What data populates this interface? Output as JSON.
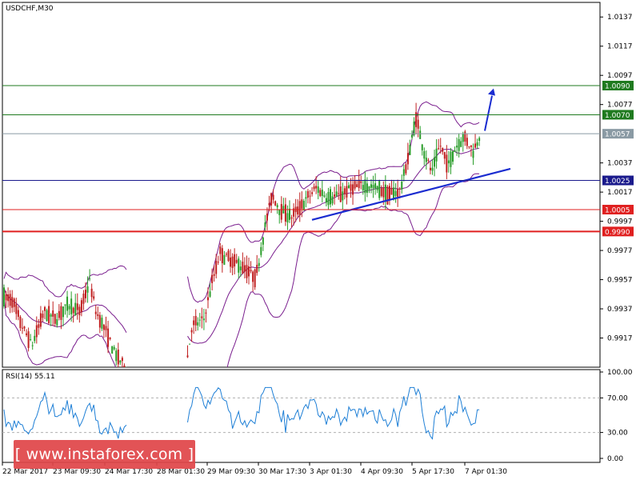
{
  "chart_data": [
    {
      "type": "candlestick",
      "title": "USDCHF,M30",
      "ylim": [
        0.9897,
        1.0147
      ],
      "yticks": [
        "1.0137",
        "1.0117",
        "1.0097",
        "1.0077",
        "1.0037",
        "1.0017",
        "0.9997",
        "0.9977",
        "0.9957",
        "0.9937",
        "0.9917"
      ],
      "xticks": [
        "22 Mar 2017",
        "23 Mar 09:30",
        "24 Mar 17:30",
        "28 Mar 01:30",
        "29 Mar 09:30",
        "30 Mar 17:30",
        "3 Apr 01:30",
        "4 Apr 09:30",
        "5 Apr 17:30",
        "7 Apr 01:30"
      ],
      "levels": [
        {
          "value": 1.009,
          "label": "1.0090",
          "color": "#1f7a1f"
        },
        {
          "value": 1.007,
          "label": "1.0070",
          "color": "#1f7a1f"
        },
        {
          "value": 1.0057,
          "label": "1.0057",
          "color": "#8a9aa4"
        },
        {
          "value": 1.0025,
          "label": "1.0025",
          "color": "#1a1a8c"
        },
        {
          "value": 1.0005,
          "label": "1.0005",
          "color": "#e02020"
        },
        {
          "value": 0.999,
          "label": "0.9990",
          "color": "#e02020"
        }
      ],
      "indicators": [
        "Bollinger Bands"
      ],
      "trendline": {
        "from": 0.9998,
        "to": 1.0033,
        "color": "#1a2cd0"
      },
      "arrow": {
        "direction": "up",
        "color": "#1a2cd0"
      },
      "candle_colors": {
        "up": "#2a9d2a",
        "down": "#c02020"
      }
    },
    {
      "type": "line",
      "title": "RSI(14) 55.11",
      "ylim": [
        0,
        100
      ],
      "yticks": [
        "100.00",
        "70.00",
        "30.00",
        "0.00"
      ],
      "levels": [
        70,
        30
      ],
      "color": "#1e7fd6"
    }
  ],
  "watermark": {
    "text": "[ www.instaforex.com ]"
  }
}
